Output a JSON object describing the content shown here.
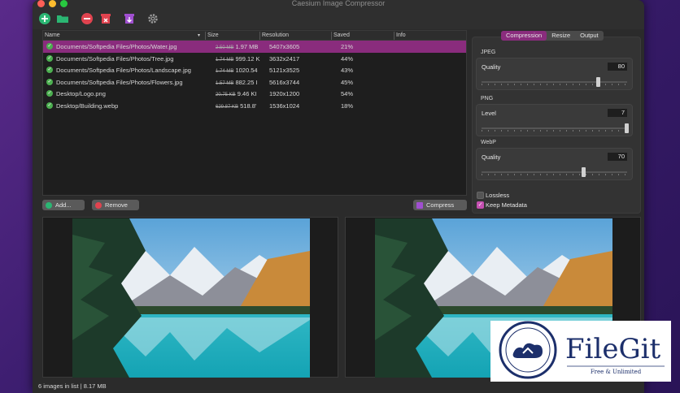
{
  "window": {
    "title": "Caesium Image Compressor"
  },
  "toolbar": [
    {
      "name": "add-icon",
      "color": "#2bb673"
    },
    {
      "name": "folder-icon",
      "color": "#2bb673"
    },
    {
      "name": "remove-icon",
      "color": "#e0434f"
    },
    {
      "name": "clear-icon",
      "color": "#e0434f"
    },
    {
      "name": "compress-icon",
      "color": "#a04fd0"
    },
    {
      "name": "settings-icon",
      "color": "#9a9a9a"
    }
  ],
  "list": {
    "columns": [
      "Name",
      "Size",
      "Resolution",
      "Saved",
      "Info"
    ],
    "rows": [
      {
        "name_prefix": "Documents/Softpedia Files/Photos/",
        "name_file": "Water.jpg",
        "old_size": "2.50 MB",
        "new_size": "1.97 MB",
        "resolution": "5407x3605",
        "saved": "21%",
        "info": ""
      },
      {
        "name_prefix": "Documents/Softpedia Files/Photos/",
        "name_file": "Tree.jpg",
        "old_size": "1.74 MB",
        "new_size": "999.12 K",
        "resolution": "3632x2417",
        "saved": "44%",
        "info": ""
      },
      {
        "name_prefix": "Documents/Softpedia Files/Photos/",
        "name_file": "Landscape.jpg",
        "old_size": "1.74 MB",
        "new_size": "1020.54",
        "resolution": "5121x3525",
        "saved": "43%",
        "info": ""
      },
      {
        "name_prefix": "Documents/Softpedia Files/Photos/",
        "name_file": "Flowers.jpg",
        "old_size": "1.57 MB",
        "new_size": "882.25 I",
        "resolution": "5616x3744",
        "saved": "45%",
        "info": ""
      },
      {
        "name_prefix": "Desktop/",
        "name_file": "Logo.png",
        "old_size": "20.75 KB",
        "new_size": "9.46 KI",
        "resolution": "1920x1200",
        "saved": "54%",
        "info": ""
      },
      {
        "name_prefix": "Desktop/",
        "name_file": "Building.webp",
        "old_size": "629.87 KB",
        "new_size": "518.8'",
        "resolution": "1536x1024",
        "saved": "18%",
        "info": ""
      }
    ]
  },
  "buttons": {
    "add": "Add...",
    "remove": "Remove",
    "compress": "Compress"
  },
  "tabs": [
    {
      "label": "Compression",
      "active": true
    },
    {
      "label": "Resize",
      "active": false
    },
    {
      "label": "Output",
      "active": false
    }
  ],
  "jpeg": {
    "section": "JPEG",
    "label": "Quality",
    "value": "80",
    "level_fraction": 0.8
  },
  "png": {
    "section": "PNG",
    "label": "Level",
    "value": "7",
    "level_fraction": 1.0
  },
  "webp": {
    "section": "WebP",
    "label": "Quality",
    "value": "70",
    "level_fraction": 0.7
  },
  "options": {
    "lossless": "Lossless",
    "lossless_checked": false,
    "keep_metadata": "Keep Metadata",
    "keep_metadata_checked": true
  },
  "status": {
    "count": "6 images in list",
    "separator": "|",
    "total_size": "8.17 MB"
  },
  "watermark": {
    "brand": "FileGit",
    "tagline": "Free & Unlimited"
  }
}
